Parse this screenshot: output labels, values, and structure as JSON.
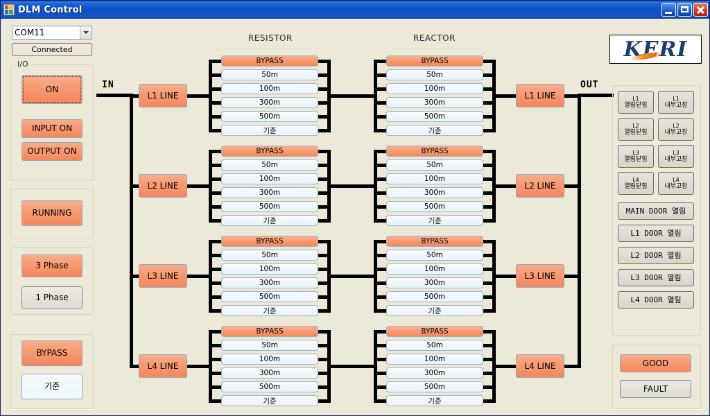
{
  "window": {
    "title": "DLM Control",
    "icon": "app-icon",
    "buttons": {
      "minimize": "minimize",
      "maximize": "maximize",
      "close": "close"
    }
  },
  "sidebar": {
    "port_select": {
      "value": "COM11",
      "options": [
        "COM11"
      ]
    },
    "connect_button": "Connected",
    "io_group": {
      "label": "I/O",
      "main_button": "ON",
      "input_button": "INPUT ON",
      "output_button": "OUTPUT ON"
    },
    "status_group": {
      "running_button": "RUNNING"
    },
    "phase_group": {
      "three_phase": "3 Phase",
      "one_phase": "1 Phase"
    },
    "mode_group": {
      "bypass": "BYPASS",
      "standard": "기준"
    }
  },
  "diagram": {
    "in_label": "IN",
    "out_label": "OUT",
    "resistor_title": "RESISTOR",
    "reactor_title": "REACTOR",
    "lines": [
      {
        "left_label": "L1 LINE",
        "right_label": "L1 LINE"
      },
      {
        "left_label": "L2 LINE",
        "right_label": "L2 LINE"
      },
      {
        "left_label": "L3 LINE",
        "right_label": "L3 LINE"
      },
      {
        "left_label": "L4 LINE",
        "right_label": "L4 LINE"
      }
    ],
    "steps": [
      "BYPASS",
      "50m",
      "100m",
      "300m",
      "500m",
      "기준"
    ],
    "active_step_index": 0
  },
  "right_panel": {
    "logo": {
      "text": "KERI"
    },
    "line_buttons": [
      {
        "top": "L1",
        "bottom": "열림닫힘",
        "top2": "L1",
        "bottom2": "내부고장"
      },
      {
        "top": "L2",
        "bottom": "열림닫힘",
        "top2": "L2",
        "bottom2": "내부고장"
      },
      {
        "top": "L3",
        "bottom": "열림닫힘",
        "top2": "L3",
        "bottom2": "내부고장"
      },
      {
        "top": "L4",
        "bottom": "열림닫힘",
        "top2": "L4",
        "bottom2": "내부고장"
      }
    ],
    "door_buttons": [
      "MAIN DOOR 열림",
      "L1 DOOR 열림",
      "L2 DOOR 열림",
      "L3 DOOR 열림",
      "L4 DOOR 열림"
    ],
    "status_group": {
      "good": "GOOD",
      "fault": "FAULT"
    }
  },
  "colors": {
    "accent_orange": "#f79a72",
    "window_bg": "#ece9d8",
    "titlebar_blue": "#0e50c0",
    "wire_black": "#000000",
    "logo_blue": "#17406e",
    "pale_blue": "#eef6fa"
  }
}
